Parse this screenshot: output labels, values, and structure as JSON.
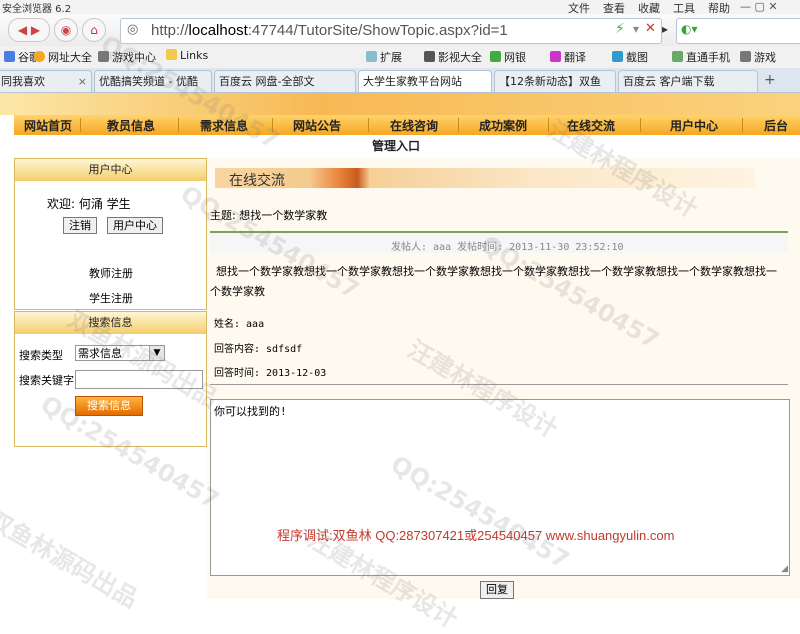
{
  "browser": {
    "title": "安全浏览器 6.2",
    "menu": [
      "文件",
      "查看",
      "收藏",
      "工具",
      "帮助"
    ],
    "address": {
      "host": "localhost",
      "rest": ":47744/TutorSite/ShowTopic.aspx?id=1",
      "prefix": "http://"
    },
    "favorites": [
      "谷歌",
      "网址大全",
      "游戏中心",
      "Links",
      "扩展",
      "影视大全",
      "网银",
      "翻译",
      "截图",
      "直通手机",
      "游戏"
    ],
    "tabs": [
      "同我喜欢",
      "优酷搞笑频道 - 优酷",
      "百度云 网盘-全部文",
      "大学生家教平台网站",
      "【12条新动态】双鱼",
      "百度云 客户端下载"
    ]
  },
  "site": {
    "nav": [
      "网站首页",
      "教员信息",
      "需求信息",
      "网站公告",
      "在线咨询",
      "成功案例",
      "在线交流",
      "用户中心",
      "后台"
    ],
    "admin_entry": "管理入口",
    "user_center": {
      "title": "用户中心",
      "welcome": "欢迎: 何涌 学生",
      "logout": "注销",
      "center_btn": "用户中心",
      "teacher_reg": "教师注册",
      "student_reg": "学生注册"
    },
    "search": {
      "title": "搜索信息",
      "type_label": "搜索类型",
      "type_value": "需求信息",
      "keyword_label": "搜索关键字",
      "keyword_value": "",
      "submit": "搜索信息"
    }
  },
  "topic": {
    "section_title": "在线交流",
    "subject": "主题: 想找一个数学家教",
    "meta": "发帖人: aaa 发帖时间: 2013-11-30 23:52:10",
    "body": "想找一个数学家教想找一个数学家教想找一个数学家教想找一个数学家教想找一个数学家教想找一个数学家教想找一个数学家教",
    "reply_name": "姓名: aaa",
    "reply_content": "回答内容: sdfsdf",
    "reply_time": "回答时间: 2013-12-03",
    "editor_text": "你可以找到的!",
    "editor_credit": "程序调试:双鱼林 QQ:287307421或254540457 www.shuangyulin.com",
    "reply_button": "回复"
  },
  "watermarks": [
    "QQ:254540457",
    "汪建林程序设计",
    "双鱼林源码出品"
  ]
}
